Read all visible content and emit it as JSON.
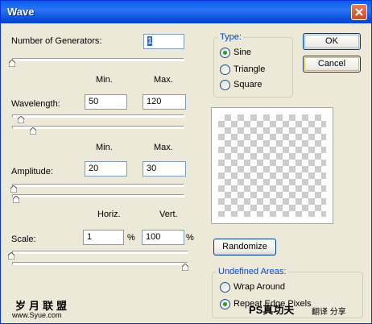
{
  "window": {
    "title": "Wave"
  },
  "generators": {
    "label": "Number of Generators:",
    "value": "1",
    "slider_fraction": 0.0
  },
  "columns": {
    "min": "Min.",
    "max": "Max.",
    "horiz": "Horiz.",
    "vert": "Vert."
  },
  "wavelength": {
    "label": "Wavelength:",
    "min": "50",
    "max": "120",
    "min_slider_fraction": 0.05,
    "max_slider_fraction": 0.12
  },
  "amplitude": {
    "label": "Amplitude:",
    "min": "20",
    "max": "30",
    "min_slider_fraction": 0.0,
    "max_slider_fraction": 0.0
  },
  "scale": {
    "label": "Scale:",
    "horiz": "1",
    "vert": "100",
    "unit": "%",
    "horiz_slider_fraction": 0.0,
    "vert_slider_fraction": 1.0
  },
  "type_group": {
    "title": "Type:",
    "options": [
      "Sine",
      "Triangle",
      "Square"
    ],
    "selected": "Sine"
  },
  "buttons": {
    "ok": "OK",
    "cancel": "Cancel",
    "randomize": "Randomize"
  },
  "undefined_areas": {
    "title": "Undefined Areas:",
    "options": [
      "Wrap Around",
      "Repeat Edge Pixels"
    ],
    "selected": "Repeat Edge Pixels"
  },
  "watermark": {
    "line1": "岁月联盟",
    "line2": "www.Syue.com",
    "brand": "PS真功夫",
    "tagline": "翻译 分享"
  }
}
